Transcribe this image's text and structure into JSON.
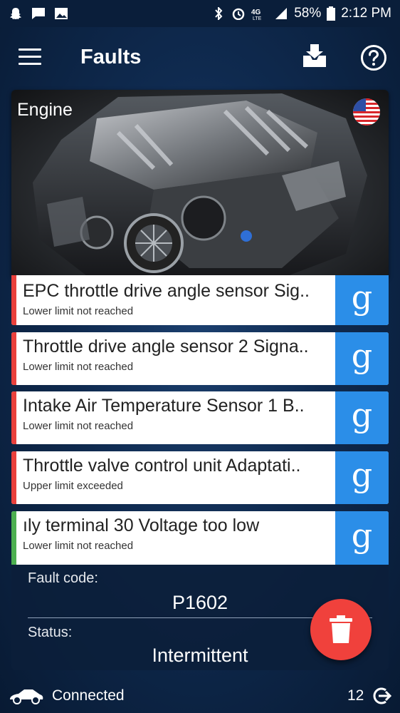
{
  "status_bar": {
    "battery": "58%",
    "time": "2:12 PM",
    "network": "4G LTE",
    "icons": [
      "snapchat-icon",
      "message-icon",
      "image-icon",
      "bluetooth-icon",
      "alarm-icon",
      "lte-icon",
      "signal-icon",
      "battery-icon"
    ]
  },
  "app_bar": {
    "title": "Faults",
    "icons": [
      "menu-icon",
      "download-icon",
      "help-icon"
    ]
  },
  "engine_card": {
    "label": "Engine",
    "flag": "us-flag-icon"
  },
  "faults": [
    {
      "name": "EPC throttle drive angle sensor Sig..",
      "detail": "Lower limit not reached",
      "color": "#e9403c"
    },
    {
      "name": "Throttle drive angle sensor 2 Signa..",
      "detail": "Lower limit not reached",
      "color": "#e9403c"
    },
    {
      "name": "Intake Air Temperature Sensor 1 B..",
      "detail": "Lower limit not reached",
      "color": "#e9403c"
    },
    {
      "name": "Throttle valve control unit Adaptati..",
      "detail": "Upper limit exceeded",
      "color": "#e9403c"
    },
    {
      "name": "ıly terminal 30 Voltage too low",
      "detail": "Lower limit not reached",
      "color": "#4caf50"
    }
  ],
  "google_glyph": "g",
  "detail_panel": {
    "fault_code_label": "Fault code:",
    "fault_code": "P1602",
    "status_label": "Status:",
    "status": "Intermittent"
  },
  "bottom_bar": {
    "connection": "Connected",
    "count": "12"
  },
  "colors": {
    "accent_blue": "#2b8ee8",
    "fab_red": "#f0413c",
    "fault_red": "#e9403c",
    "fault_green": "#4caf50"
  }
}
